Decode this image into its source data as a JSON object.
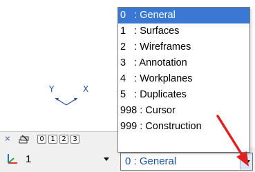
{
  "viewport": {
    "triad": {
      "x_label": "X",
      "y_label": "Y"
    }
  },
  "layer_toolbar": {
    "tabs": [
      "0",
      "1",
      "2",
      "3"
    ]
  },
  "coord_system": {
    "value": "1"
  },
  "layer_combo": {
    "value": "0  : General"
  },
  "layer_dropdown": {
    "items": [
      {
        "label": "0   : General",
        "selected": true
      },
      {
        "label": "1   : Surfaces",
        "selected": false
      },
      {
        "label": "2   : Wireframes",
        "selected": false
      },
      {
        "label": "3   : Annotation",
        "selected": false
      },
      {
        "label": "4   : Workplanes",
        "selected": false
      },
      {
        "label": "5   : Duplicates",
        "selected": false
      },
      {
        "label": "998 : Cursor",
        "selected": false
      },
      {
        "label": "999 : Construction",
        "selected": false
      }
    ]
  },
  "colors": {
    "selection": "#3a78d3",
    "annotation_arrow": "#e02020",
    "triad_label": "#2a4ea0"
  }
}
